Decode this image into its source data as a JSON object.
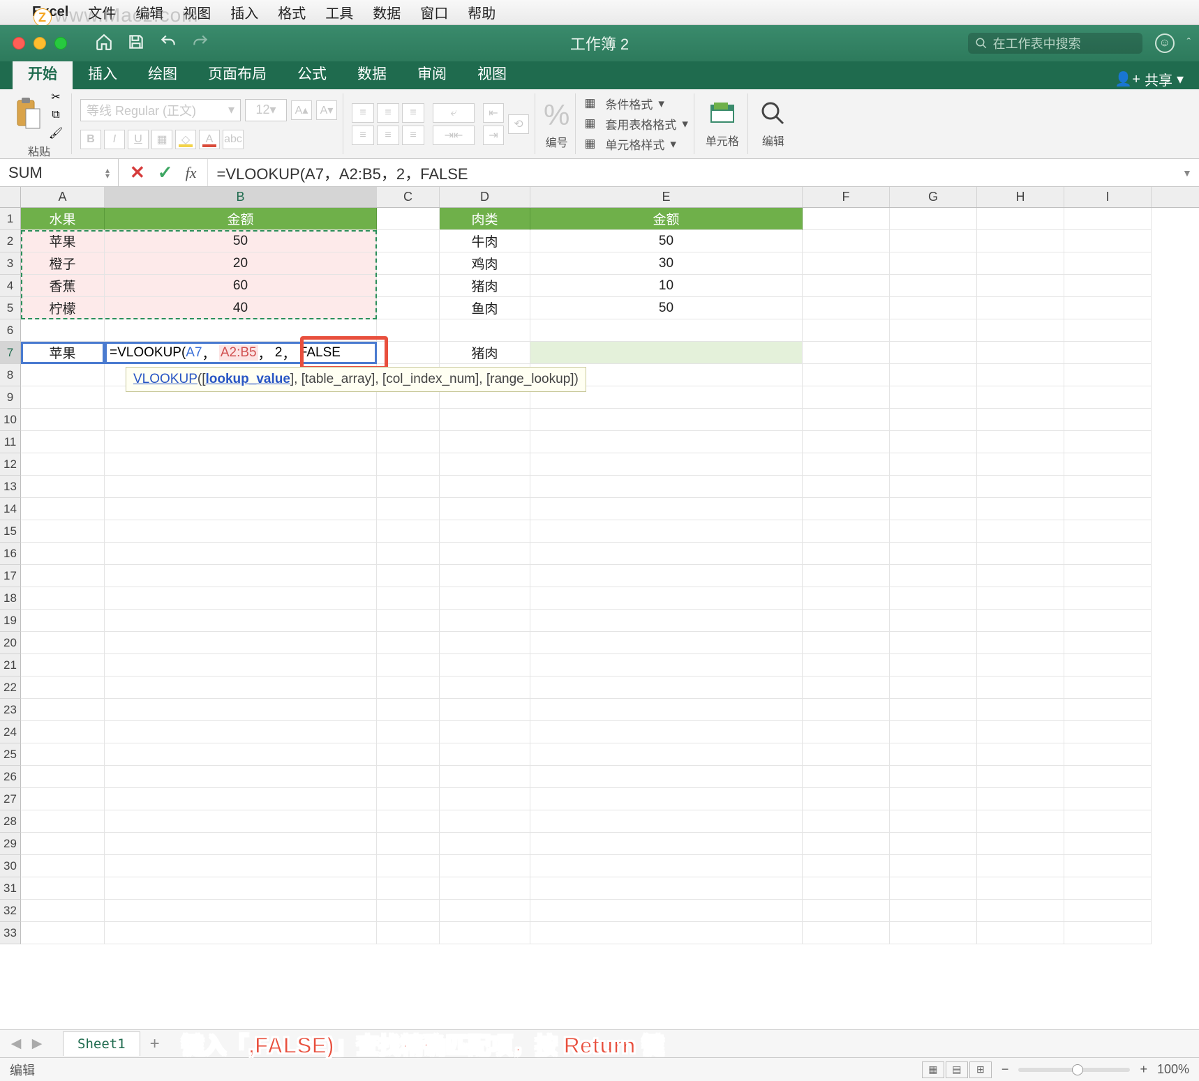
{
  "mac_menu": {
    "app": "Excel",
    "items": [
      "文件",
      "编辑",
      "视图",
      "插入",
      "格式",
      "工具",
      "数据",
      "窗口",
      "帮助"
    ]
  },
  "watermark": "www.Macz.com",
  "titlebar": {
    "doc": "工作簿 2",
    "search_ph": "在工作表中搜索"
  },
  "ribbon_tabs": {
    "active": "开始",
    "others": [
      "插入",
      "绘图",
      "页面布局",
      "公式",
      "数据",
      "审阅",
      "视图"
    ],
    "share": "共享"
  },
  "ribbon": {
    "paste": "粘贴",
    "font_name": "等线 Regular (正文)",
    "font_size": "12",
    "number_label": "编号",
    "styles": {
      "cond": "条件格式",
      "table": "套用表格格式",
      "cell": "单元格样式"
    },
    "cells_label": "单元格",
    "edit_label": "编辑"
  },
  "formula_bar": {
    "name_box": "SUM",
    "formula": "=VLOOKUP(A7，A2:B5，2，FALSE"
  },
  "columns": [
    "A",
    "B",
    "C",
    "D",
    "E",
    "F",
    "G",
    "H",
    "I"
  ],
  "col_widths": [
    "cA",
    "cB",
    "cC",
    "cD",
    "cE",
    "cF",
    "cG",
    "cH",
    "cI"
  ],
  "row_count": 33,
  "data": {
    "A1": "水果",
    "B1": "金额",
    "D1": "肉类",
    "E1": "金额",
    "A2": "苹果",
    "B2": "50",
    "D2": "牛肉",
    "E2": "50",
    "A3": "橙子",
    "B3": "20",
    "D3": "鸡肉",
    "E3": "30",
    "A4": "香蕉",
    "B4": "60",
    "D4": "猪肉",
    "E4": "10",
    "A5": "柠檬",
    "B5": "40",
    "D5": "鱼肉",
    "E5": "50",
    "A7": "苹果",
    "D7": "猪肉"
  },
  "edit": {
    "prefix": "=VLOOKUP(",
    "a7": "A7",
    "sep1": "，",
    "rng": "A2:B5",
    "sep2": "，",
    "two": "2",
    "sep3": "，",
    "false": "FALSE",
    "cursor": "|"
  },
  "tooltip": {
    "fname": "VLOOKUP",
    "open": "([",
    "arg1": "lookup_value",
    "rest": "], [table_array], [col_index_num], [range_lookup])"
  },
  "sheet": {
    "name": "Sheet1",
    "instruction": "键入「,FALSE)」查找精确匹配项，按 Return 键"
  },
  "status": {
    "mode": "编辑",
    "zoom": "100%"
  }
}
